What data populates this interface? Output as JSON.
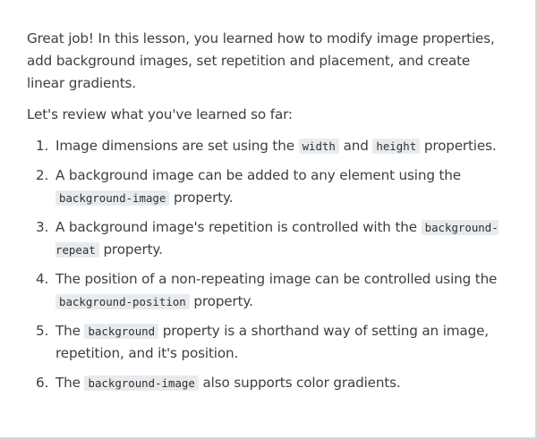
{
  "summary": {
    "intro": "Great job! In this lesson, you learned how to modify image properties, add background images, set repetition and placement, and create linear gradients.",
    "review_heading": "Let's review what you've learned so far:"
  },
  "review_items": [
    {
      "number": "1.",
      "parts": [
        "Image dimensions are set using the ",
        "width",
        " and ",
        "height",
        " properties."
      ]
    },
    {
      "number": "2.",
      "parts": [
        "A background image can be added to any element using the ",
        "background-image",
        " property."
      ]
    },
    {
      "number": "3.",
      "parts": [
        "A background image's repetition is controlled with the ",
        "background-repeat",
        " property."
      ]
    },
    {
      "number": "4.",
      "parts": [
        "The position of a non-repeating image can be controlled using the ",
        "background-position",
        " property."
      ]
    },
    {
      "number": "5.",
      "parts": [
        "The ",
        "background",
        " property is a shorthand way of setting an image, repetition, and it's position."
      ]
    },
    {
      "number": "6.",
      "parts": [
        "The ",
        "background-image",
        " also supports color gradients."
      ]
    }
  ]
}
